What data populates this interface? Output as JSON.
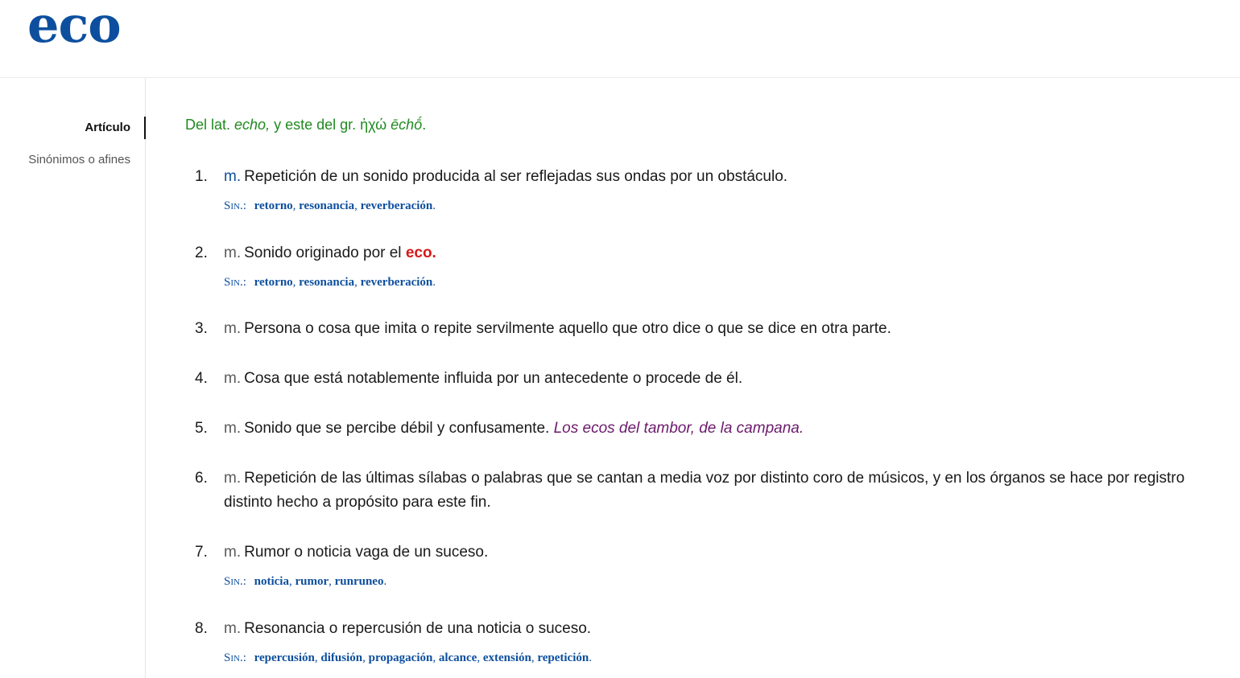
{
  "headword": "eco",
  "sidebar": {
    "items": [
      {
        "label": "Artículo",
        "active": true
      },
      {
        "label": "Sinónimos o afines",
        "active": false
      }
    ]
  },
  "etymology": {
    "prefix": "Del lat. ",
    "latin": "echo,",
    "middle": " y este del gr. ἠχώ ",
    "greek_translit": "ēchṓ",
    "suffix": "."
  },
  "senses": [
    {
      "num": "1.",
      "abbr": "m.",
      "text": "Repetición de un sonido producida al ser reflejadas sus ondas por un obstáculo.",
      "syn_label": "Sin.:",
      "synonyms": [
        "retorno",
        "resonancia",
        "reverberación"
      ]
    },
    {
      "num": "2.",
      "abbr": "m.",
      "text": "Sonido originado por el ",
      "xref": "eco.",
      "syn_label": "Sin.:",
      "synonyms": [
        "retorno",
        "resonancia",
        "reverberación"
      ]
    },
    {
      "num": "3.",
      "abbr": "m.",
      "text": "Persona o cosa que imita o repite servilmente aquello que otro dice o que se dice en otra parte."
    },
    {
      "num": "4.",
      "abbr": "m.",
      "text": "Cosa que está notablemente influida por un antecedente o procede de él."
    },
    {
      "num": "5.",
      "abbr": "m.",
      "text": "Sonido que se percibe débil y confusamente. ",
      "example": "Los ecos del tambor, de la campana."
    },
    {
      "num": "6.",
      "abbr": "m.",
      "text": "Repetición de las últimas sílabas o palabras que se cantan a media voz por distinto coro de músicos, y en los órganos se hace por registro distinto hecho a propósito para este fin."
    },
    {
      "num": "7.",
      "abbr": "m.",
      "text": "Rumor o noticia vaga de un suceso.",
      "syn_label": "Sin.:",
      "synonyms": [
        "noticia",
        "rumor",
        "runruneo"
      ]
    },
    {
      "num": "8.",
      "abbr": "m.",
      "text": "Resonancia o repercusión de una noticia o suceso.",
      "syn_label": "Sin.:",
      "synonyms": [
        "repercusión",
        "difusión",
        "propagación",
        "alcance",
        "extensión",
        "repetición"
      ]
    }
  ],
  "colors": {
    "headword": "#0d4f9e",
    "etymology": "#1f8a1f",
    "xref": "#d61a1a",
    "example": "#6b1a6b",
    "synonym": "#0d4f9e"
  }
}
